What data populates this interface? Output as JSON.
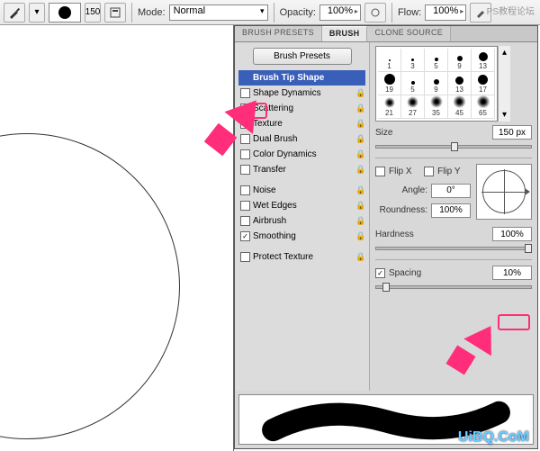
{
  "toolbar": {
    "brush_size_chip": "150",
    "mode_label": "Mode:",
    "mode_value": "Normal",
    "opacity_label": "Opacity:",
    "opacity_value": "100%",
    "flow_label": "Flow:",
    "flow_value": "100%"
  },
  "tabs": {
    "presets": "BRUSH PRESETS",
    "brush": "BRUSH",
    "clone": "CLONE SOURCE"
  },
  "leftcol": {
    "presets_btn": "Brush Presets",
    "tip_shape": "Brush Tip Shape",
    "items": [
      {
        "label": "Shape Dynamics",
        "checked": false,
        "lock": true
      },
      {
        "label": "Scattering",
        "checked": false,
        "lock": true
      },
      {
        "label": "Texture",
        "checked": false,
        "lock": true
      },
      {
        "label": "Dual Brush",
        "checked": false,
        "lock": true
      },
      {
        "label": "Color Dynamics",
        "checked": false,
        "lock": true
      },
      {
        "label": "Transfer",
        "checked": false,
        "lock": true
      },
      {
        "label": "Noise",
        "checked": false,
        "lock": true
      },
      {
        "label": "Wet Edges",
        "checked": false,
        "lock": true
      },
      {
        "label": "Airbrush",
        "checked": false,
        "lock": true
      },
      {
        "label": "Smoothing",
        "checked": true,
        "lock": true
      },
      {
        "label": "Protect Texture",
        "checked": false,
        "lock": true
      }
    ]
  },
  "grid": {
    "r1": [
      {
        "n": "1",
        "s": 2
      },
      {
        "n": "3",
        "s": 3
      },
      {
        "n": "5",
        "s": 4
      },
      {
        "n": "9",
        "s": 6
      },
      {
        "n": "13",
        "s": 10
      }
    ],
    "r2": [
      {
        "n": "19",
        "s": 12
      },
      {
        "n": "5",
        "s": 4
      },
      {
        "n": "9",
        "s": 6
      },
      {
        "n": "13",
        "s": 9
      },
      {
        "n": "17",
        "s": 11
      }
    ],
    "r3": [
      {
        "n": "21",
        "s": 12,
        "soft": true
      },
      {
        "n": "27",
        "s": 13,
        "soft": true
      },
      {
        "n": "35",
        "s": 14,
        "soft": true
      },
      {
        "n": "45",
        "s": 15,
        "soft": true
      },
      {
        "n": "65",
        "s": 16,
        "soft": true
      }
    ]
  },
  "settings": {
    "size_label": "Size",
    "size_value": "150 px",
    "flipx": "Flip X",
    "flipy": "Flip Y",
    "angle_label": "Angle:",
    "angle_value": "0°",
    "roundness_label": "Roundness:",
    "roundness_value": "100%",
    "hardness_label": "Hardness",
    "hardness_value": "100%",
    "spacing_label": "Spacing",
    "spacing_value": "10%"
  },
  "watermark": "UiBQ.CoM",
  "wm2": "PS教程论坛"
}
